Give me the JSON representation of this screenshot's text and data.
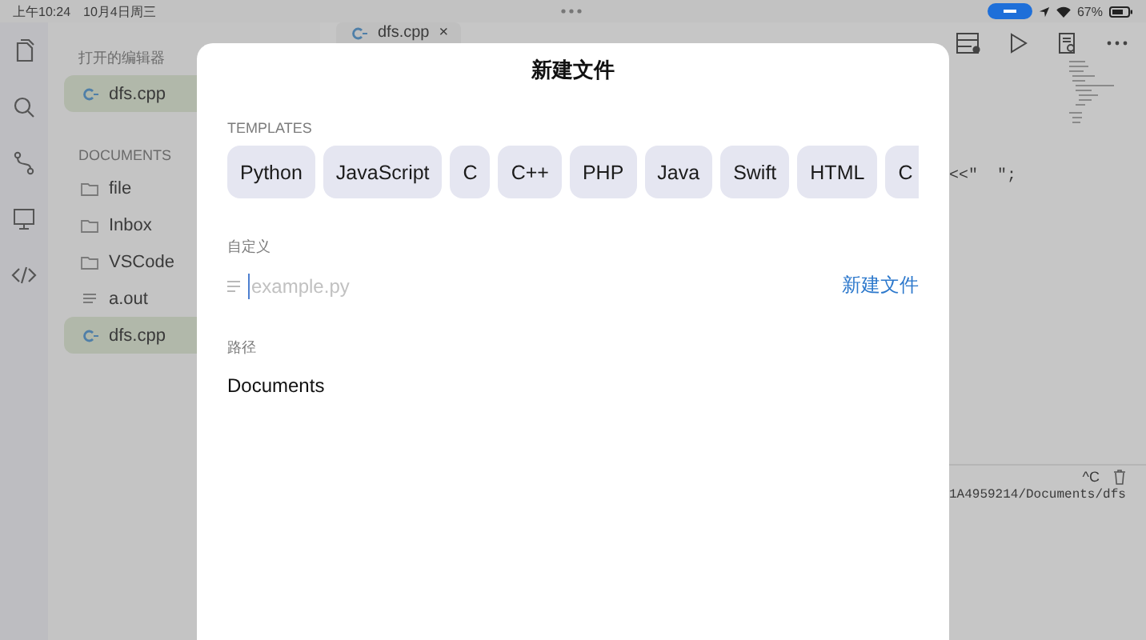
{
  "status_bar": {
    "time": "上午10:24",
    "date": "10月4日周三",
    "battery": "67%"
  },
  "sidebar": {
    "open_editors": {
      "title": "打开的编辑器",
      "items": [
        {
          "name": "dfs.cpp",
          "kind": "cpp",
          "selected": true
        }
      ]
    },
    "documents": {
      "title": "DOCUMENTS",
      "items": [
        {
          "name": "file",
          "kind": "folder",
          "selected": false
        },
        {
          "name": "Inbox",
          "kind": "folder",
          "selected": false
        },
        {
          "name": "VSCode",
          "kind": "folder",
          "selected": false
        },
        {
          "name": "a.out",
          "kind": "text",
          "selected": false
        },
        {
          "name": "dfs.cpp",
          "kind": "cpp",
          "selected": true
        }
      ]
    }
  },
  "editor": {
    "tab": {
      "label": "dfs.cpp",
      "close": "×"
    },
    "code_line": "<<\"  \";",
    "terminal": {
      "interrupt": "^C",
      "path": "1A4959214/Documents/dfs"
    }
  },
  "modal": {
    "title": "新建文件",
    "templates_label": "TEMPLATES",
    "templates": [
      {
        "label": "Python"
      },
      {
        "label": "JavaScript"
      },
      {
        "label": "C"
      },
      {
        "label": "C++"
      },
      {
        "label": "PHP"
      },
      {
        "label": "Java"
      },
      {
        "label": "Swift"
      },
      {
        "label": "HTML"
      },
      {
        "label": "C"
      }
    ],
    "custom_label": "自定义",
    "filename": {
      "placeholder": "example.py"
    },
    "create": "新建文件",
    "path_label": "路径",
    "path": "Documents"
  }
}
